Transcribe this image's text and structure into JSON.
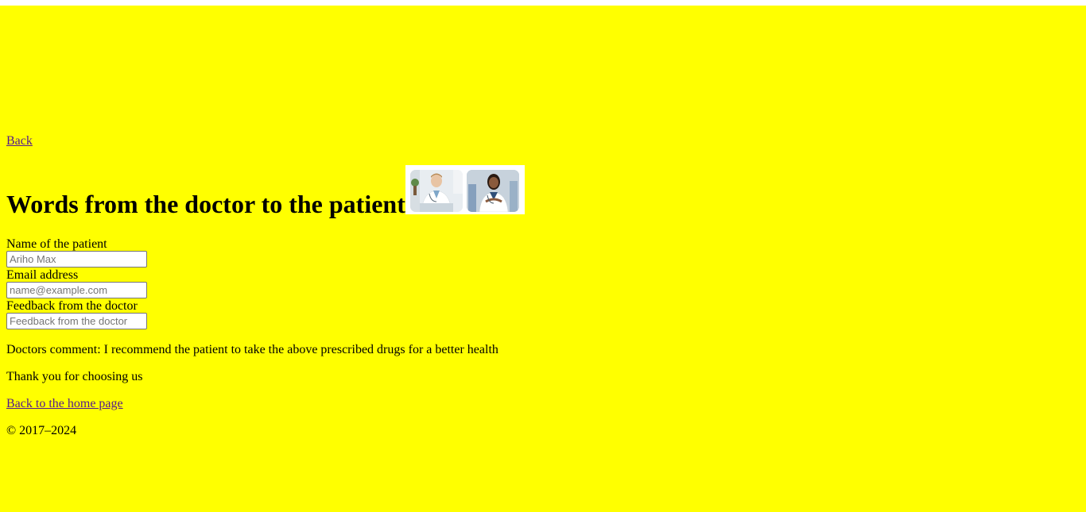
{
  "nav": {
    "back_label": "Back"
  },
  "header": {
    "title": "Words from the doctor to the patient",
    "image_alt": "doctor-photos"
  },
  "form": {
    "patient_name": {
      "label": "Name of the patient",
      "value": "",
      "placeholder": "Ariho Max"
    },
    "email": {
      "label": "Email address",
      "value": "",
      "placeholder": "name@example.com"
    },
    "feedback": {
      "label": "Feedback from the doctor",
      "value": "",
      "placeholder": "Feedback from the doctor"
    }
  },
  "content": {
    "comment": "Doctors comment: I recommend the patient to take the above prescribed drugs for a better health",
    "thanks": "Thank you for choosing us",
    "home_link": "Back to the home page",
    "copyright": "© 2017–2024"
  },
  "colors": {
    "page_background": "#ffff00",
    "link": "#551a8b"
  }
}
